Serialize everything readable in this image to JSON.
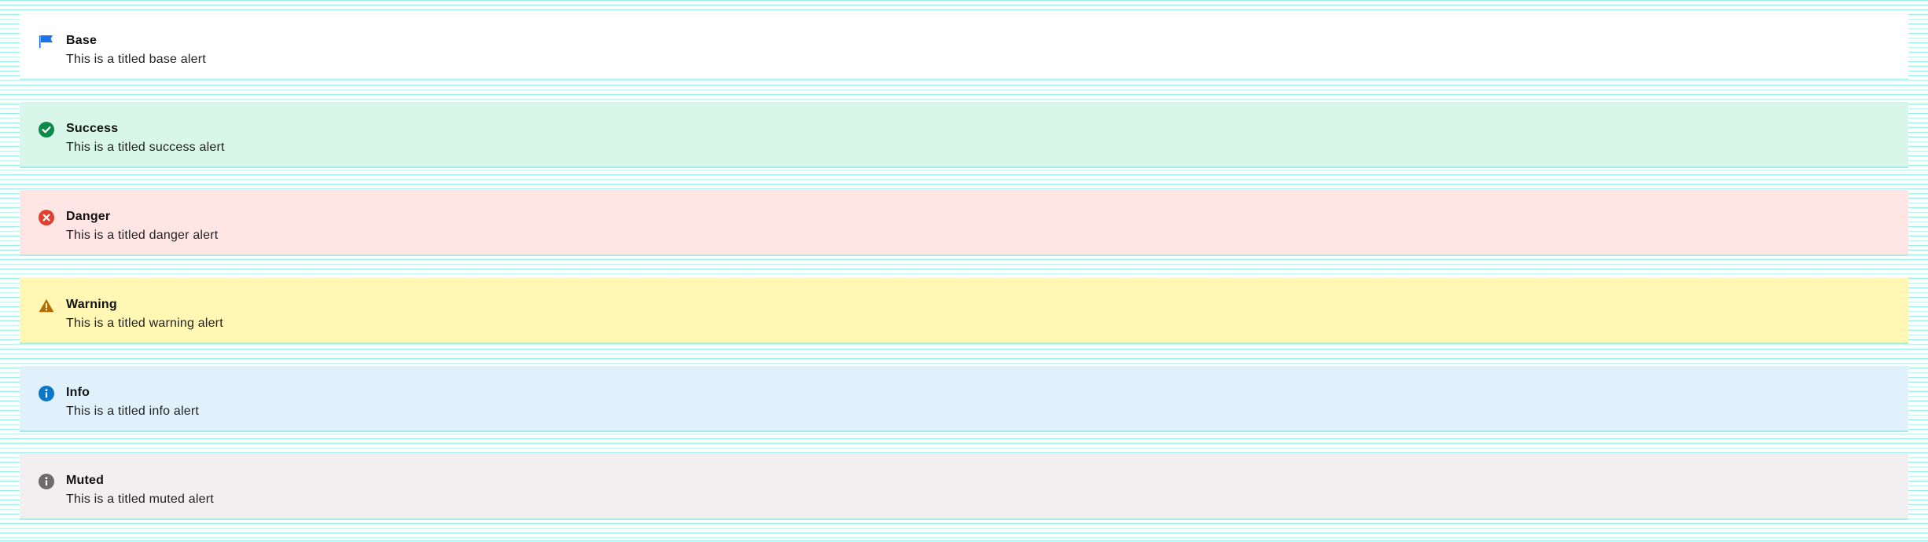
{
  "alerts": [
    {
      "variant": "base",
      "title": "Base",
      "text": "This is a titled base alert",
      "icon": "flag-icon",
      "color": "#1a73e8"
    },
    {
      "variant": "success",
      "title": "Success",
      "text": "This is a titled success alert",
      "icon": "check-circle-icon",
      "color": "#0b8a4a"
    },
    {
      "variant": "danger",
      "title": "Danger",
      "text": "This is a titled danger alert",
      "icon": "x-circle-icon",
      "color": "#e0402f"
    },
    {
      "variant": "warning",
      "title": "Warning",
      "text": "This is a titled warning alert",
      "icon": "warning-icon",
      "color": "#b06d00"
    },
    {
      "variant": "info",
      "title": "Info",
      "text": "This is a titled info alert",
      "icon": "info-icon",
      "color": "#0b78c9"
    },
    {
      "variant": "muted",
      "title": "Muted",
      "text": "This is a titled muted alert",
      "icon": "info-muted-icon",
      "color": "#6d6b6c"
    }
  ]
}
